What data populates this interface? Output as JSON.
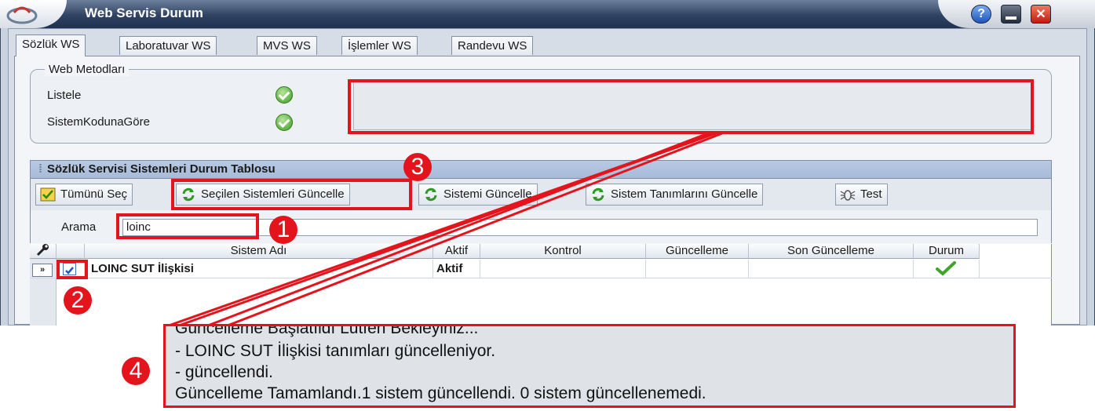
{
  "window": {
    "title": "Web Servis Durum",
    "help_icon": "help-icon",
    "minimize_icon": "minimize-icon",
    "close_icon": "close-icon"
  },
  "tabs": [
    {
      "label": "Sözlük WS",
      "active": true
    },
    {
      "label": "Laboratuvar WS",
      "active": false
    },
    {
      "label": "MVS WS",
      "active": false
    },
    {
      "label": "İşlemler WS",
      "active": false
    },
    {
      "label": "Randevu WS",
      "active": false
    }
  ],
  "web_methods": {
    "legend": "Web Metodları",
    "items": [
      {
        "label": "Listele",
        "status_icon": "check-circle-icon"
      },
      {
        "label": "SistemKodunaGöre",
        "status_icon": "check-circle-icon"
      }
    ],
    "output_text": ""
  },
  "panel": {
    "title": "Sözlük Servisi Sistemleri Durum Tablosu",
    "toolbar": [
      {
        "label": "Tümünü Seç",
        "icon": "select-all-icon"
      },
      {
        "label": "Seçilen Sistemleri Güncelle",
        "icon": "refresh-icon"
      },
      {
        "label": "Sistemi Güncelle",
        "icon": "refresh-icon"
      },
      {
        "label": "Sistem Tanımlarını Güncelle",
        "icon": "refresh-icon"
      },
      {
        "label": "Test",
        "icon": "bug-icon"
      }
    ],
    "search": {
      "label": "Arama",
      "value": "loinc"
    },
    "columns": [
      "Sistem Adı",
      "Aktif",
      "Kontrol",
      "Güncelleme",
      "Son Güncelleme",
      "Durum"
    ],
    "rows": [
      {
        "checked": true,
        "name": "LOINC SUT İlişkisi",
        "aktif": "Aktif",
        "kontrol": "",
        "guncelleme": "",
        "son_guncelleme": "",
        "durum_icon": "green-check-icon"
      }
    ]
  },
  "log": {
    "lines": [
      "Güncelleme Başlatıldı Lütfen Bekleyiniz...",
      " - LOINC SUT İlişkisi tanımları güncelleniyor.",
      " - güncellendi.",
      "Güncelleme Tamamlandı.1 sistem güncellendi. 0 sistem güncellenemedi."
    ]
  },
  "annotations": {
    "marker_1": "1",
    "marker_2": "2",
    "marker_3": "3",
    "marker_4": "4",
    "color": "#e3141c"
  }
}
